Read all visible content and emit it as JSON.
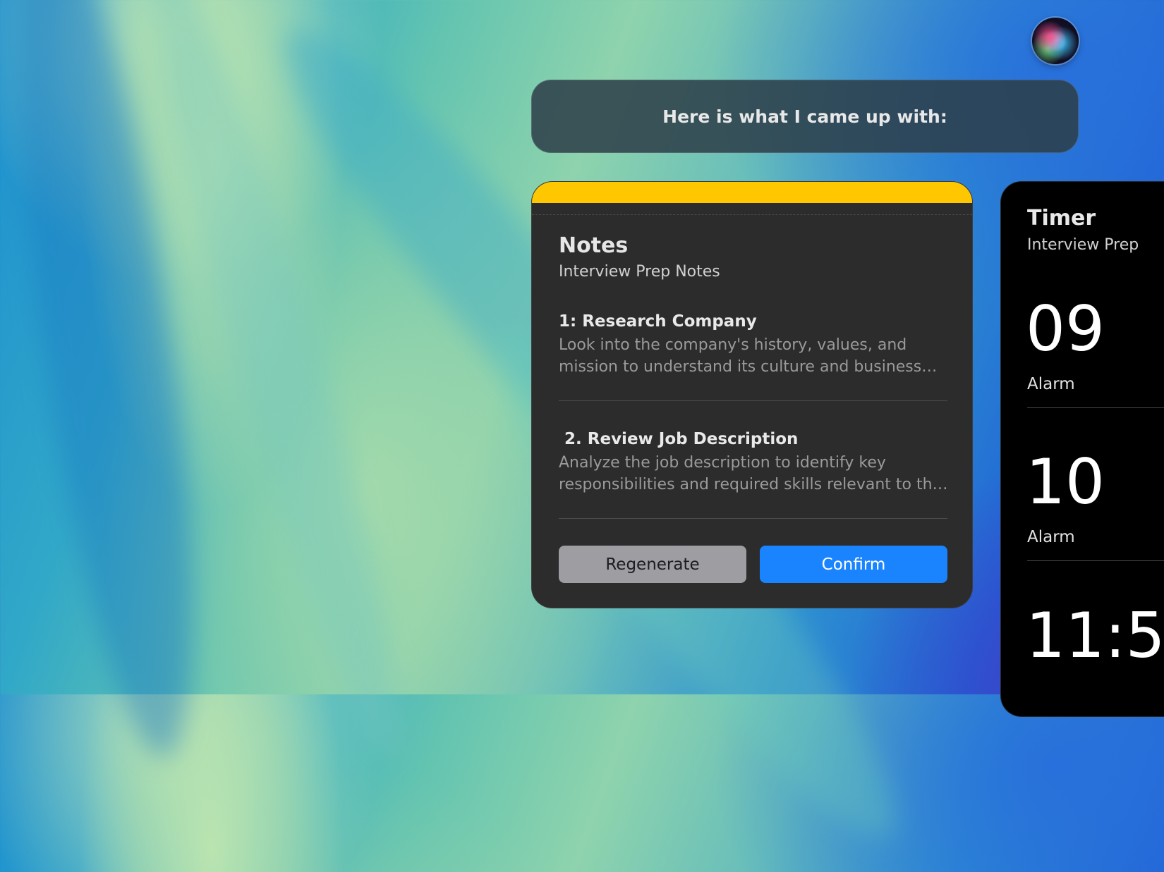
{
  "siri": {
    "icon": "siri-orb-icon"
  },
  "response": {
    "text": "Here is what I came up with:"
  },
  "notes_card": {
    "accent_color": "#fec700",
    "title": "Notes",
    "subtitle": "Interview Prep Notes",
    "items": [
      {
        "heading": "1: Research Company",
        "body": "Look into the company's history, values, and mission to understand its culture and business goals."
      },
      {
        "heading": " 2. Review Job Description",
        "body": "Analyze the job description to identify key responsibilities and required skills relevant to the role."
      }
    ],
    "regenerate_label": "Regenerate",
    "confirm_label": "Confirm",
    "confirm_color": "#1a84ff"
  },
  "timer_card": {
    "title": "Timer",
    "subtitle": "Interview Prep",
    "alarms": [
      {
        "time": "09",
        "label": "Alarm"
      },
      {
        "time": "10",
        "label": "Alarm"
      },
      {
        "time": "11:5",
        "label": ""
      }
    ]
  }
}
